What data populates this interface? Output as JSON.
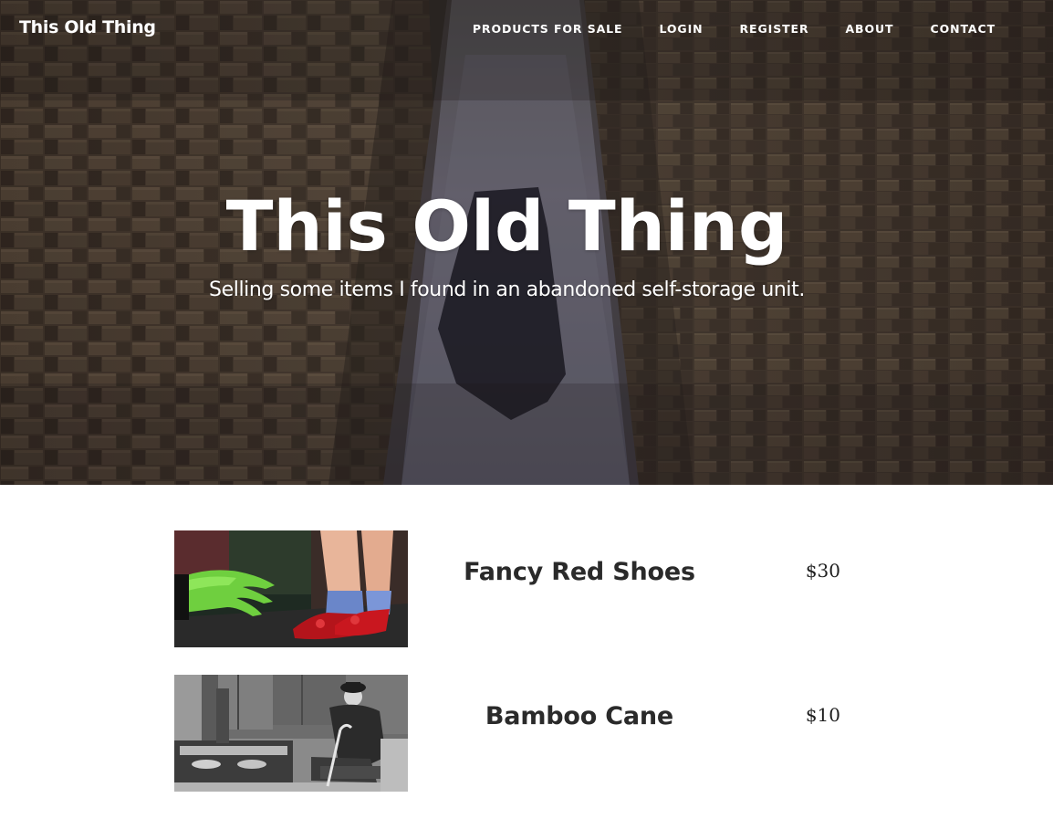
{
  "site": {
    "brand": "This Old Thing"
  },
  "nav": {
    "items": [
      {
        "label": "PRODUCTS FOR SALE"
      },
      {
        "label": "LOGIN"
      },
      {
        "label": "REGISTER"
      },
      {
        "label": "ABOUT"
      },
      {
        "label": "CONTACT"
      }
    ]
  },
  "hero": {
    "title": "This Old Thing",
    "subtitle": "Selling some items I found in an abandoned self-storage unit.",
    "background": "warehouse-aisle-photo"
  },
  "products": [
    {
      "name": "Fancy Red Shoes",
      "price": "$30",
      "image": "ruby-slippers-photo"
    },
    {
      "name": "Bamboo Cane",
      "price": "$10",
      "image": "chaplin-cane-photo"
    }
  ],
  "colors": {
    "hero_overlay": "#2b2a33",
    "heading_text": "#2a2a2a",
    "nav_text": "#ffffff"
  }
}
